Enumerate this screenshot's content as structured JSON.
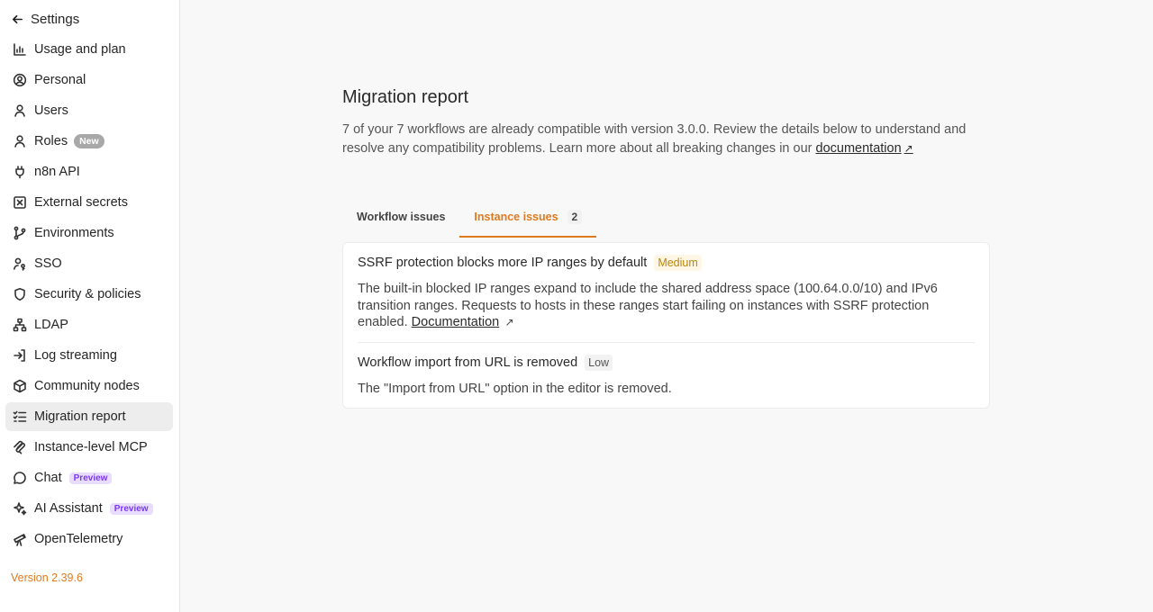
{
  "sidebar": {
    "back_label": "Settings",
    "items": [
      {
        "label": "Usage and plan",
        "icon": "chart-icon"
      },
      {
        "label": "Personal",
        "icon": "user-circle-icon"
      },
      {
        "label": "Users",
        "icon": "user-icon"
      },
      {
        "label": "Roles",
        "icon": "user-icon",
        "badge": "New"
      },
      {
        "label": "n8n API",
        "icon": "plug-icon"
      },
      {
        "label": "External secrets",
        "icon": "x-square-icon"
      },
      {
        "label": "Environments",
        "icon": "git-branch-icon"
      },
      {
        "label": "SSO",
        "icon": "user-key-icon"
      },
      {
        "label": "Security & policies",
        "icon": "shield-icon"
      },
      {
        "label": "LDAP",
        "icon": "network-icon"
      },
      {
        "label": "Log streaming",
        "icon": "log-in-icon"
      },
      {
        "label": "Community nodes",
        "icon": "box-icon"
      },
      {
        "label": "Migration report",
        "icon": "list-checks-icon",
        "active": true
      },
      {
        "label": "Instance-level MCP",
        "icon": "mcp-icon"
      },
      {
        "label": "Chat",
        "icon": "chat-icon",
        "preview": "Preview"
      },
      {
        "label": "AI Assistant",
        "icon": "sparkles-icon",
        "preview": "Preview"
      },
      {
        "label": "OpenTelemetry",
        "icon": "telescope-icon"
      }
    ],
    "version": "Version 2.39.6"
  },
  "main": {
    "title": "Migration report",
    "description": "7 of your 7 workflows are already compatible with version 3.0.0. Review the details below to understand and resolve any compatibility problems. Learn more about all breaking changes in our ",
    "doc_link": "documentation",
    "tabs": [
      {
        "label": "Workflow issues"
      },
      {
        "label": "Instance issues",
        "count": "2",
        "active": true
      }
    ],
    "issues": [
      {
        "title": "SSRF protection blocks more IP ranges by default",
        "severity": "Medium",
        "description": "The built-in blocked IP ranges expand to include the shared address space (100.64.0.0/10) and IPv6 transition ranges. Requests to hosts in these ranges start failing on instances with SSRF protection enabled. ",
        "link": "Documentation"
      },
      {
        "title": "Workflow import from URL is removed",
        "severity": "Low",
        "description": "The \"Import from URL\" option in the editor is removed."
      }
    ],
    "colors": {
      "accent": "#e07a1f",
      "medium": "#b8860b",
      "preview": "#7c3aed"
    }
  }
}
